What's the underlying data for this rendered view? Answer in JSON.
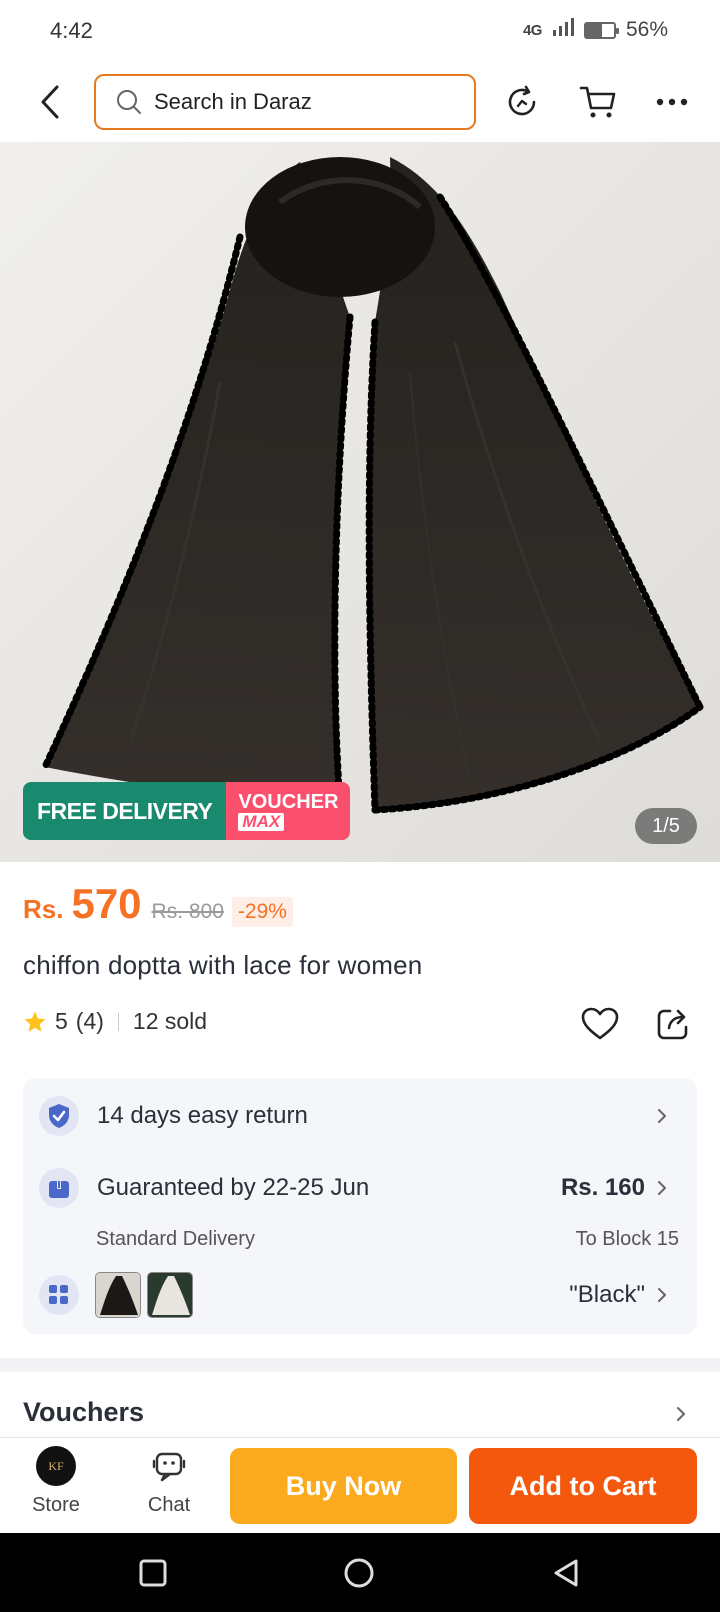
{
  "status_bar": {
    "time": "4:42",
    "network": "4G",
    "battery_percent": "56%",
    "battery_level": 0.56
  },
  "header": {
    "search_placeholder": "Search in Daraz"
  },
  "hero": {
    "badge_free_delivery": "FREE DELIVERY",
    "badge_voucher": "VOUCHER",
    "badge_voucher_sub": "MAX",
    "image_counter": "1/5"
  },
  "product": {
    "currency": "Rs.",
    "price": "570",
    "original_price": "Rs. 800",
    "discount": "-29%",
    "title": "chiffon doptta with lace for women",
    "rating": "5",
    "rating_count": "(4)",
    "sold": "12 sold"
  },
  "info": {
    "return_text": "14 days easy return",
    "delivery_title": "Guaranteed by 22-25 Jun",
    "delivery_sub": "Standard Delivery",
    "delivery_price": "Rs. 160",
    "delivery_location": "To Block 15",
    "variant_selected": "\"Black\""
  },
  "vouchers_label": "Vouchers",
  "action_bar": {
    "store_label": "Store",
    "store_logo_text": "KF",
    "chat_label": "Chat",
    "buy_now": "Buy Now",
    "add_to_cart": "Add to Cart"
  },
  "colors": {
    "accent": "#f57224",
    "buy_now": "#fbaa1f",
    "add_to_cart": "#f3580d",
    "free_delivery": "#1a8a6e",
    "voucher": "#fb4f6e"
  }
}
